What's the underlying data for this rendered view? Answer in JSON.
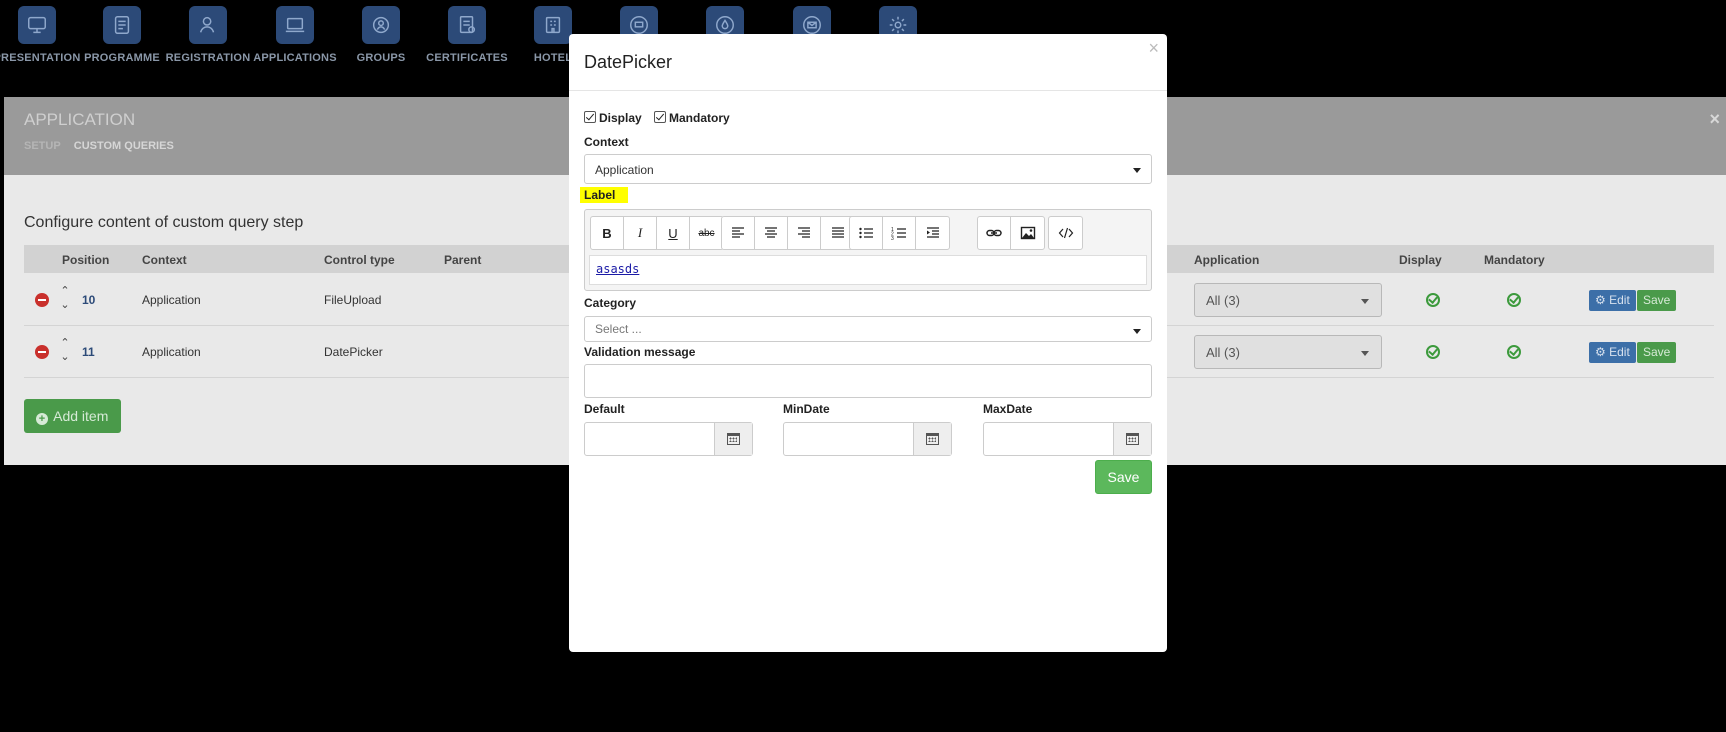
{
  "nav": {
    "items": [
      {
        "label": "PRESENTATION",
        "icon": "presentation-icon"
      },
      {
        "label": "PROGRAMME",
        "icon": "programme-icon"
      },
      {
        "label": "REGISTRATION",
        "icon": "registration-icon"
      },
      {
        "label": "APPLICATIONS",
        "icon": "applications-icon"
      },
      {
        "label": "GROUPS",
        "icon": "groups-icon"
      },
      {
        "label": "CERTIFICATES",
        "icon": "certificates-icon"
      },
      {
        "label": "HOTEL",
        "icon": "hotel-icon"
      },
      {
        "label": "",
        "icon": "monitor-icon"
      },
      {
        "label": "",
        "icon": "drop-icon"
      },
      {
        "label": "",
        "icon": "mail-icon"
      },
      {
        "label": "",
        "icon": "gear-icon"
      }
    ]
  },
  "app": {
    "title": "APPLICATION",
    "close": "×",
    "tabs": [
      "SETUP",
      "CUSTOM QUERIES"
    ],
    "section_title": "Configure content of custom query step",
    "columns": [
      "Position",
      "Context",
      "Control type",
      "Parent",
      "Application",
      "Display",
      "Mandatory"
    ],
    "rows": [
      {
        "position": "10",
        "context": "Application",
        "control_type": "FileUpload",
        "application": "All (3)",
        "edit": "Edit",
        "save": "Save"
      },
      {
        "position": "11",
        "context": "Application",
        "control_type": "DatePicker",
        "application": "All (3)",
        "edit": "Edit",
        "save": "Save"
      }
    ],
    "add_item": "Add item"
  },
  "modal": {
    "title": "DatePicker",
    "close": "×",
    "display_label": "Display",
    "mandatory_label": "Mandatory",
    "display_checked": true,
    "mandatory_checked": true,
    "context_label": "Context",
    "context_value": "Application",
    "label_label": "Label",
    "editor_content": "asasds",
    "category_label": "Category",
    "category_placeholder": "Select ...",
    "validation_label": "Validation message",
    "validation_value": "",
    "default_label": "Default",
    "mindate_label": "MinDate",
    "maxdate_label": "MaxDate",
    "save_label": "Save"
  },
  "colors": {
    "nav_icon_bg": "#2c4a78",
    "highlight": "#ffff00",
    "save_green": "#5cb85c",
    "edit_blue": "#3c6fa8",
    "remove_red": "#c9302c"
  }
}
